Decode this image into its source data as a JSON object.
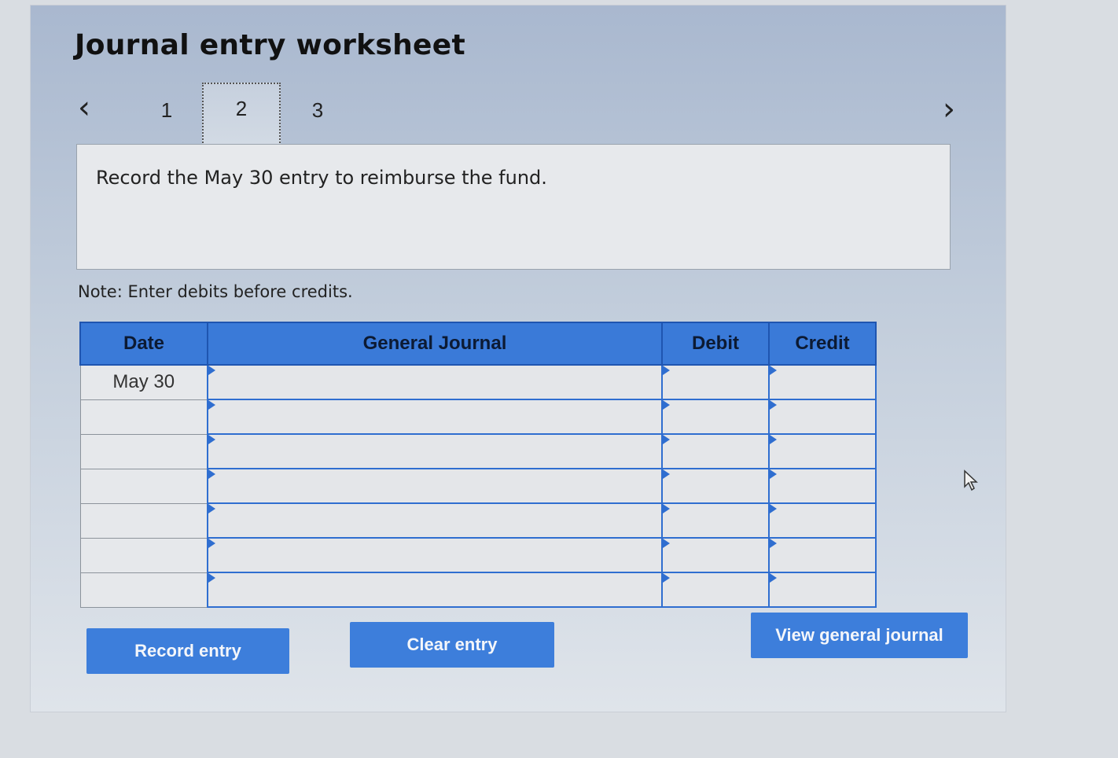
{
  "worksheet": {
    "title": "Journal entry worksheet",
    "steps": [
      "1",
      "2",
      "3"
    ],
    "active_step": "2",
    "instruction": "Record the May 30 entry to reimburse the fund.",
    "note": "Note: Enter debits before credits."
  },
  "table": {
    "headers": {
      "date": "Date",
      "general_journal": "General Journal",
      "debit": "Debit",
      "credit": "Credit"
    },
    "rows": [
      {
        "date": "May 30",
        "account": "",
        "debit": "",
        "credit": ""
      },
      {
        "date": "",
        "account": "",
        "debit": "",
        "credit": ""
      },
      {
        "date": "",
        "account": "",
        "debit": "",
        "credit": ""
      },
      {
        "date": "",
        "account": "",
        "debit": "",
        "credit": ""
      },
      {
        "date": "",
        "account": "",
        "debit": "",
        "credit": ""
      },
      {
        "date": "",
        "account": "",
        "debit": "",
        "credit": ""
      },
      {
        "date": "",
        "account": "",
        "debit": "",
        "credit": ""
      }
    ]
  },
  "buttons": {
    "record": "Record entry",
    "clear": "Clear entry",
    "view": "View general journal"
  },
  "icons": {
    "prev": "chevron-left-icon",
    "next": "chevron-right-icon",
    "cursor": "mouse-pointer-icon"
  },
  "colors": {
    "accent": "#3a7ad8",
    "border": "#2f6ed0"
  }
}
